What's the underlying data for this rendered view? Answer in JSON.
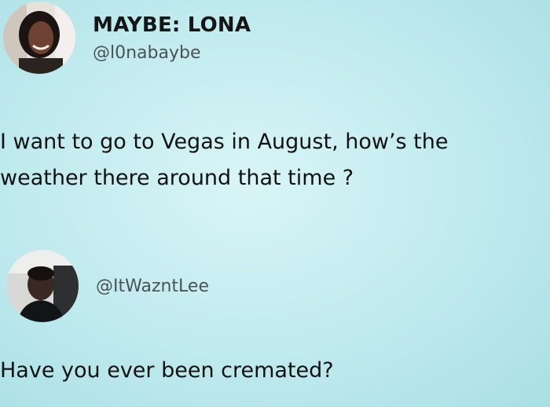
{
  "tweets": [
    {
      "display_name": "MAYBE: LONA",
      "handle": "@l0nabaybe",
      "text_line1": "I want to go to Vegas in August, how’s the",
      "text_line2": "weather there around that time ?",
      "avatar_icon": "user-avatar-photo"
    },
    {
      "display_name": "",
      "handle": "@ItWazntLee",
      "text_line1": "Have you ever been cremated?",
      "avatar_icon": "user-avatar-photo"
    }
  ]
}
